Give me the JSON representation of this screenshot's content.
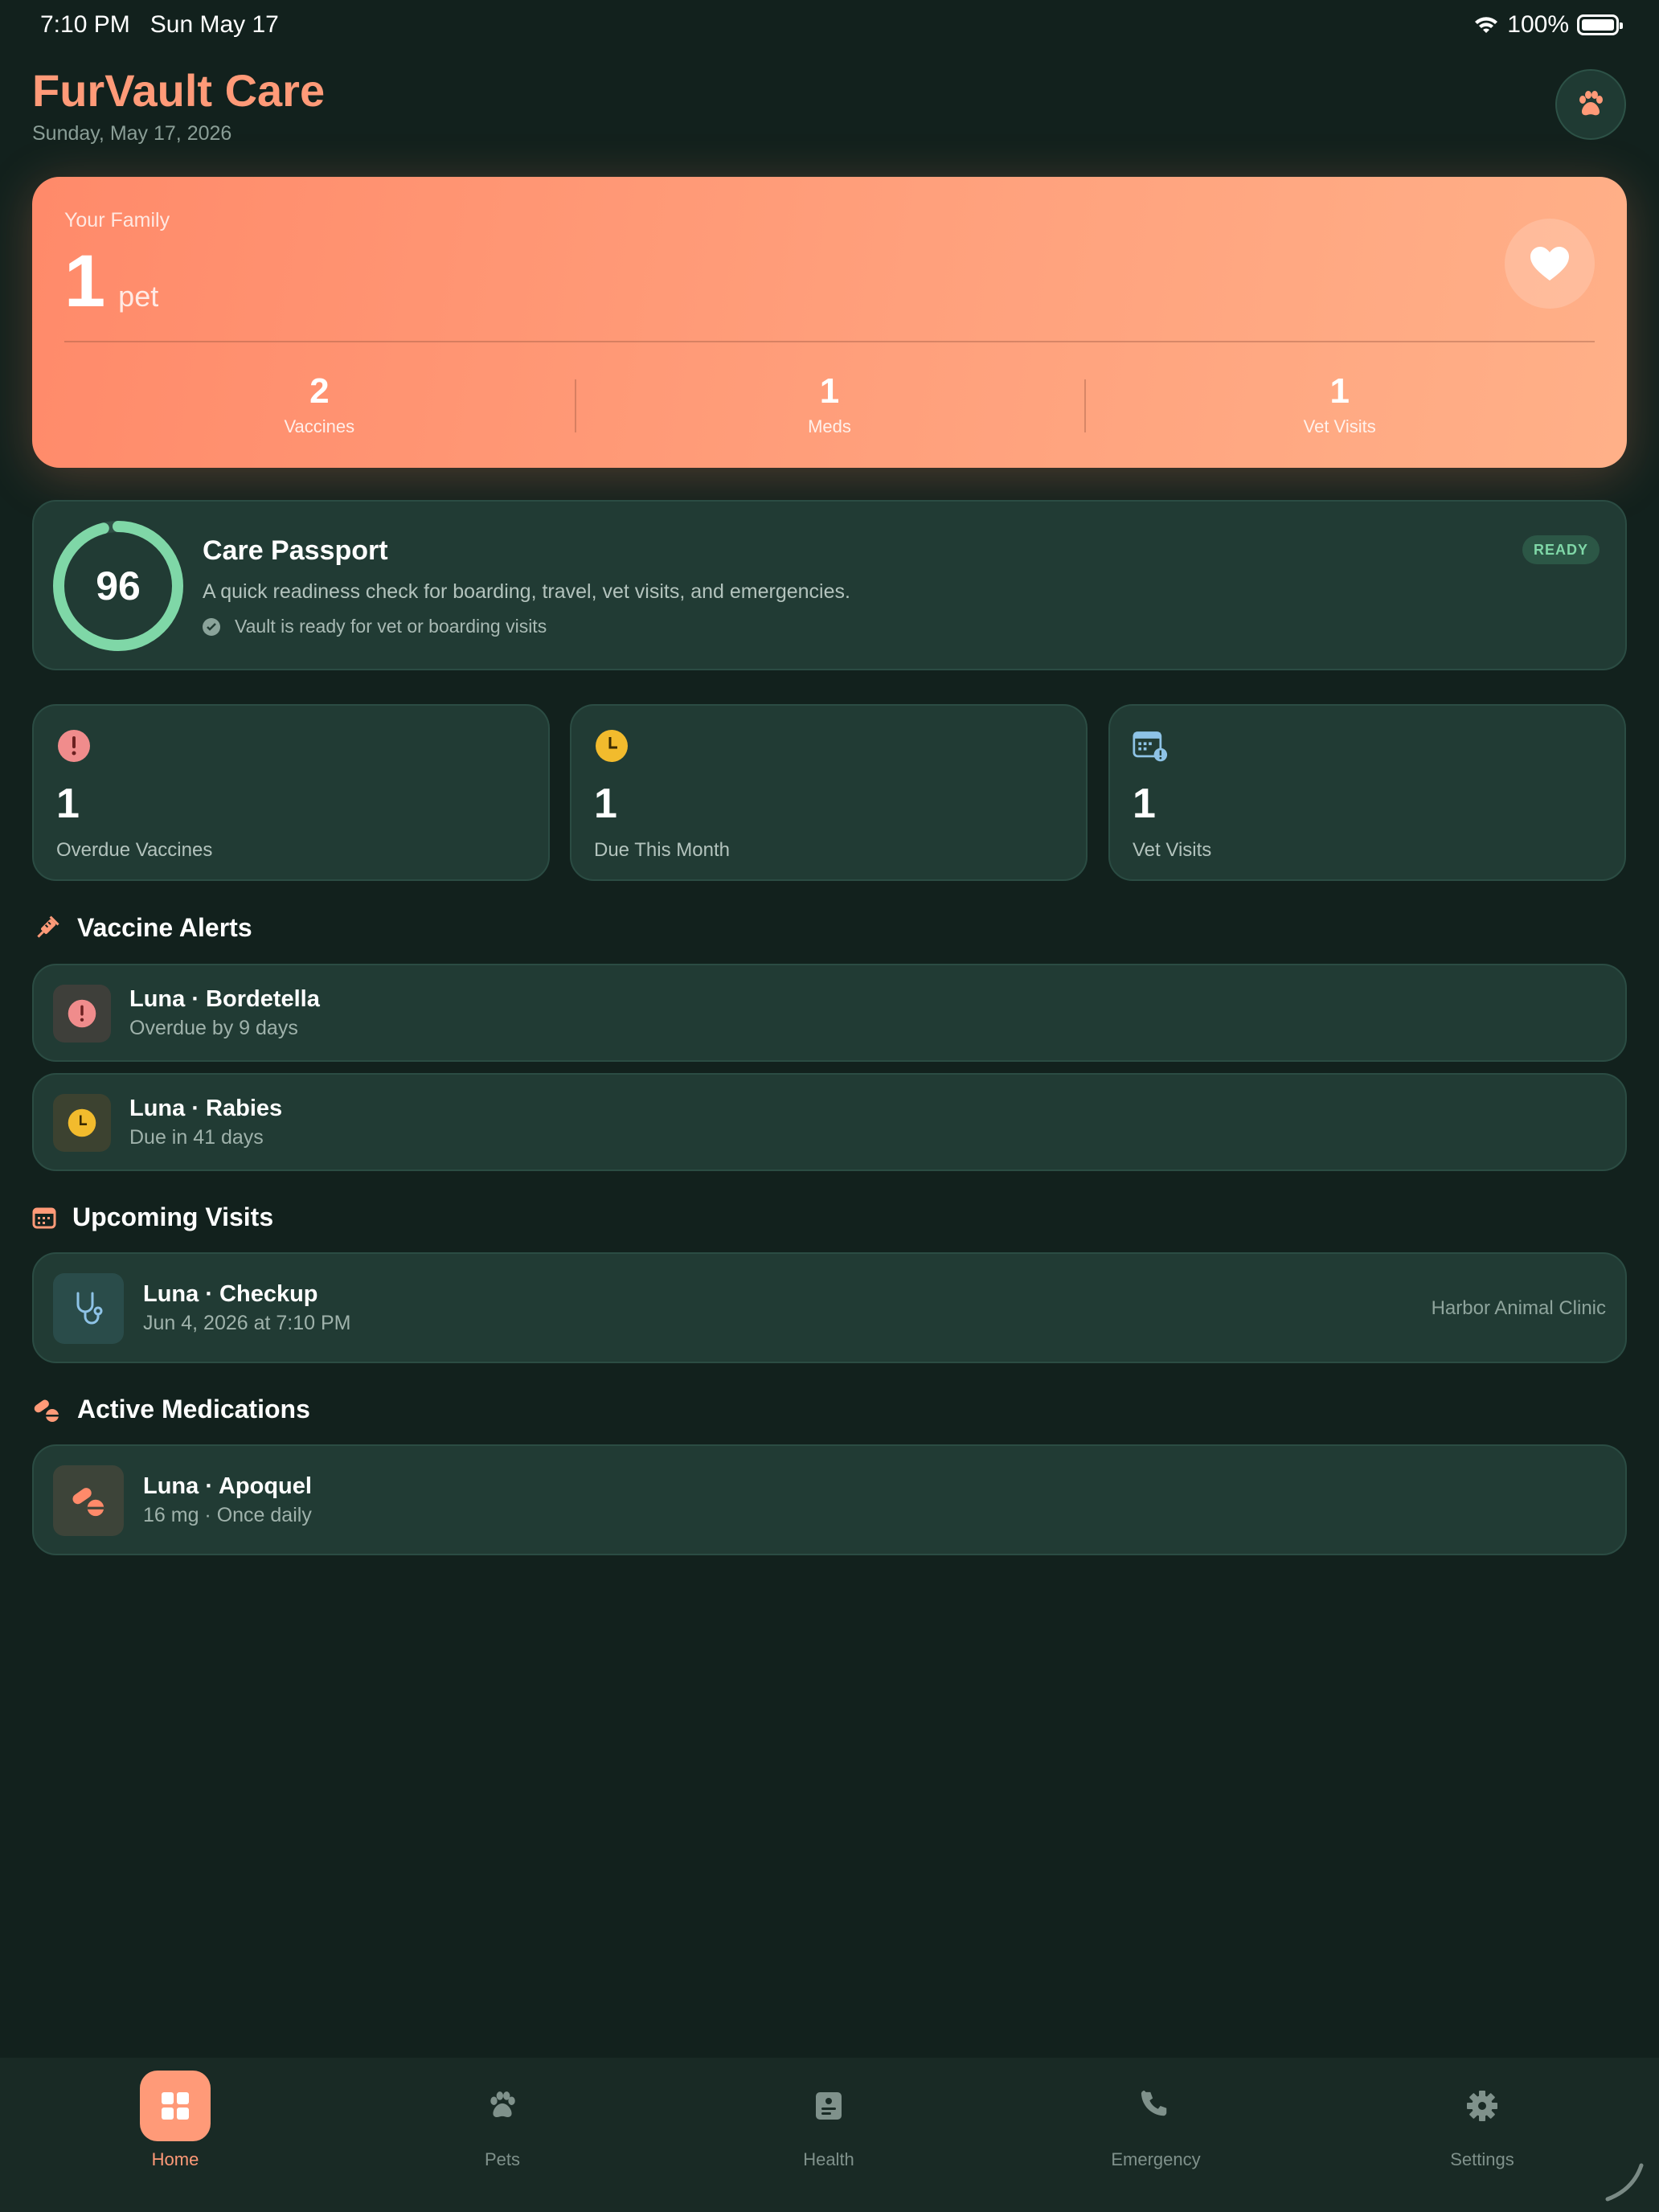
{
  "status_bar": {
    "time": "7:10 PM",
    "date": "Sun May 17",
    "battery": "100%"
  },
  "header": {
    "title": "FurVault Care",
    "date": "Sunday, May 17, 2026"
  },
  "family": {
    "label": "Your Family",
    "count": "1",
    "unit": "pet",
    "stats": [
      {
        "value": "2",
        "label": "Vaccines"
      },
      {
        "value": "1",
        "label": "Meds"
      },
      {
        "value": "1",
        "label": "Vet Visits"
      }
    ]
  },
  "passport": {
    "score": "96",
    "score_fraction": 0.96,
    "title": "Care Passport",
    "description": "A quick readiness check for boarding, travel, vet visits, and emergencies.",
    "check": "Vault is ready for vet or boarding visits",
    "badge": "READY"
  },
  "tiles": [
    {
      "value": "1",
      "label": "Overdue Vaccines",
      "icon": "alert-icon"
    },
    {
      "value": "1",
      "label": "Due This Month",
      "icon": "clock-icon"
    },
    {
      "value": "1",
      "label": "Vet Visits",
      "icon": "calendar-alert-icon"
    }
  ],
  "vaccine_alerts": {
    "title": "Vaccine Alerts",
    "items": [
      {
        "title": "Luna · Bordetella",
        "subtitle": "Overdue by 9 days"
      },
      {
        "title": "Luna · Rabies",
        "subtitle": "Due in 41 days"
      }
    ]
  },
  "upcoming_visits": {
    "title": "Upcoming Visits",
    "items": [
      {
        "title": "Luna · Checkup",
        "subtitle": "Jun 4, 2026 at 7:10 PM",
        "location": "Harbor Animal Clinic"
      }
    ]
  },
  "medications": {
    "title": "Active Medications",
    "items": [
      {
        "title": "Luna · Apoquel",
        "subtitle": "16 mg · Once daily"
      }
    ]
  },
  "tabs": [
    {
      "label": "Home",
      "icon": "grid-icon",
      "active": true
    },
    {
      "label": "Pets",
      "icon": "paw-icon"
    },
    {
      "label": "Health",
      "icon": "health-record-icon"
    },
    {
      "label": "Emergency",
      "icon": "phone-icon"
    },
    {
      "label": "Settings",
      "icon": "gear-icon"
    }
  ],
  "colors": {
    "accent": "#ff9a78",
    "background": "#12211d",
    "card": "#213b34",
    "ready_green": "#7fd7a7",
    "overdue_red": "#f08c8c",
    "due_yellow": "#f2bb2d"
  }
}
